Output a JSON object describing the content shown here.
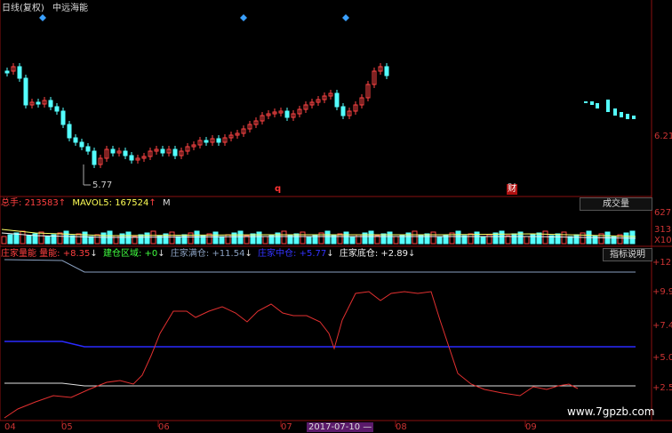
{
  "price_panel": {
    "title": "日线(复权)",
    "stock_name": "中远海能",
    "price_label": "6.21",
    "low_label": "5.77",
    "marker_q": "q",
    "marker_cai": "财"
  },
  "volume_panel": {
    "total_label": "总手:",
    "total_value": "213583",
    "mavol_label": "MAVOL5:",
    "mavol_value": "167524",
    "m_label": "M",
    "up_arrow": "↑",
    "button_label": "成交量",
    "y_ticks": [
      "627",
      "313",
      "X10"
    ]
  },
  "indicator_panel": {
    "name": "庄家量能 量能:",
    "value1": "+8.35",
    "label2": "建仓区域:",
    "value2": "+0",
    "label3": "庄家满仓:",
    "value3": "+11.54",
    "label4": "庄家中仓:",
    "value4": "+5.77",
    "label5": "庄家底仓:",
    "value5": "+2.89",
    "arrow_up": "↑",
    "arrow_down": "↓",
    "button_label": "指标说明",
    "y_ticks": [
      "+12.",
      "+9.9",
      "+7.4",
      "+5.0",
      "+2.5"
    ]
  },
  "x_axis": {
    "labels": [
      "04",
      "05",
      "06",
      "07",
      "08",
      "09"
    ],
    "date_highlight": "2017-07-10 —"
  },
  "watermark": "www.7gpzb.com",
  "colors": {
    "up": "#ff4444",
    "down": "#54ffff",
    "line_red": "#e23030",
    "line_blue": "#2a2aff",
    "line_white": "#e0e0e0",
    "line_gray": "#8aa0c0",
    "divider": "#8a1010"
  }
}
